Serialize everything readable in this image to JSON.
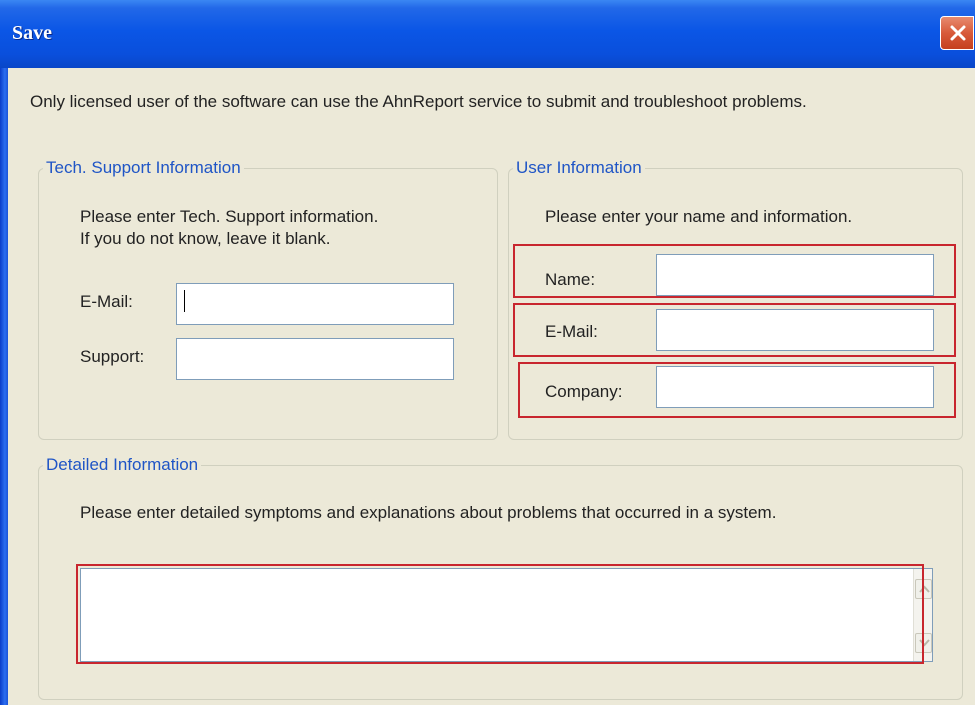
{
  "window": {
    "title": "Save"
  },
  "intro_text": "Only licensed user of the software can use the AhnReport service to submit and troubleshoot problems.",
  "tech_support": {
    "legend": "Tech. Support Information",
    "instruction_line1": "Please enter Tech. Support information.",
    "instruction_line2": "If you do not know, leave it blank.",
    "email_label": "E-Mail:",
    "email_value": "",
    "support_label": "Support:",
    "support_value": ""
  },
  "user_info": {
    "legend": "User Information",
    "instruction": "Please enter your name and information.",
    "name_label": "Name:",
    "name_value": "",
    "email_label": "E-Mail:",
    "email_value": "",
    "company_label": "Company:",
    "company_value": ""
  },
  "detailed": {
    "legend": "Detailed Information",
    "instruction": "Please enter detailed symptoms and explanations about problems that occurred in a system.",
    "value": ""
  },
  "icons": {
    "close": "close-icon",
    "scroll_up": "scroll-up-arrow-icon",
    "scroll_down": "scroll-down-arrow-icon"
  },
  "colors": {
    "titlebar": "#0a4fdc",
    "highlight": "#c8262e",
    "legend_text": "#1f55c6",
    "dialog_bg": "#ece9d8"
  }
}
